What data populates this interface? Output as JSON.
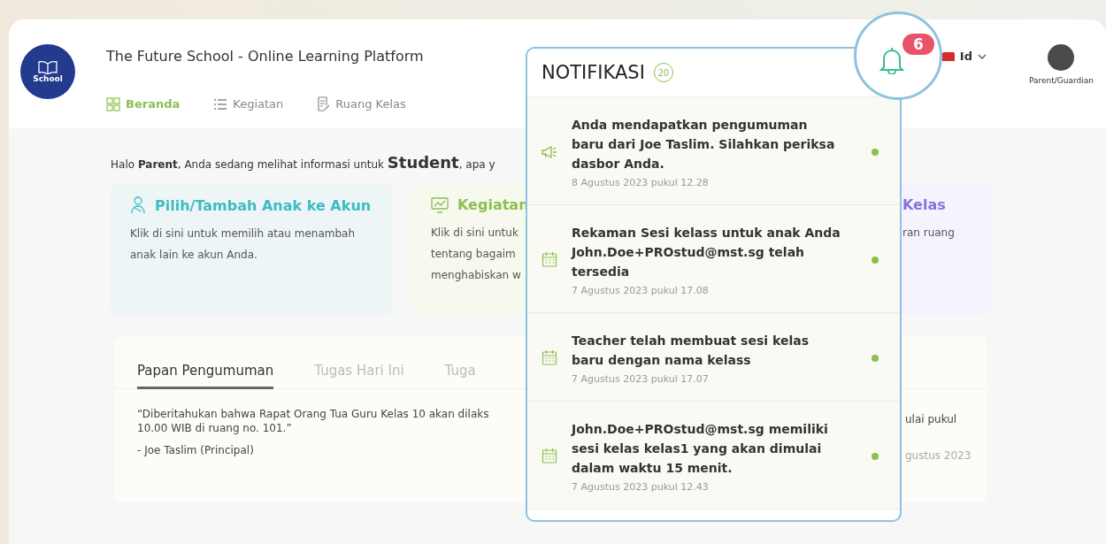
{
  "header": {
    "logo_text": "School",
    "title": "The Future School - Online Learning Platform",
    "nav": [
      {
        "label": "Beranda",
        "selected": true
      },
      {
        "label": "Kegiatan",
        "selected": false
      },
      {
        "label": "Ruang Kelas",
        "selected": false
      }
    ],
    "notification_count": "6",
    "language": "Id",
    "profile_label": "Parent/Guardian"
  },
  "greeting": "Halo **Parent**, Anda sedang melihat informasi untuk **Student**, apa y",
  "cards": [
    {
      "kind": "child",
      "title": "Pilih/Tambah Anak ke Akun",
      "text": "Klik di sini untuk memilih atau menambah anak lain ke akun Anda.",
      "color": "#3cbcc4"
    },
    {
      "kind": "activity",
      "title": "Kegiatan",
      "text": "Klik di sini untuk\ntentang bagaim\nmenghabiskan w",
      "color": "#8cbf4e"
    },
    {
      "kind": "class",
      "title": "Kelas",
      "text": "ran ruang",
      "color": "#8a6fe0"
    }
  ],
  "board": {
    "tabs": [
      {
        "label": "Papan Pengumuman",
        "selected": true
      },
      {
        "label": "Tugas Hari Ini",
        "selected": false
      },
      {
        "label": "Tuga",
        "selected": false
      }
    ],
    "announcement": "“Diberitahukan bahwa Rapat Orang Tua Guru Kelas 10 akan dilaks\n10.00 WIB di ruang no. 101.”",
    "author": "- Joe Taslim (Principal)",
    "cut_text": "ulai pukul",
    "cut_date": "gustus 2023"
  },
  "notifications": {
    "title": "NOTIFIKASI",
    "count": "20",
    "items": [
      {
        "kind": "announcement",
        "text": "Anda mendapatkan pengumuman baru dari Joe Taslim. Silahkan periksa dasbor Anda.",
        "date": "8 Agustus 2023 pukul 12.28",
        "unread": true
      },
      {
        "kind": "class",
        "text": "Rekaman Sesi kelass untuk anak Anda John.Doe+PROstud@mst.sg telah tersedia",
        "date": "7 Agustus 2023 pukul 17.08",
        "unread": true
      },
      {
        "kind": "class",
        "text": "Teacher telah membuat sesi kelas baru dengan nama kelass",
        "date": "7 Agustus 2023 pukul 17.07",
        "unread": true
      },
      {
        "kind": "class",
        "text": "John.Doe+PROstud@mst.sg memiliki sesi kelas kelas1 yang akan dimulai dalam waktu 15 menit.",
        "date": "7 Agustus 2023 pukul 12.43",
        "unread": true
      }
    ]
  }
}
